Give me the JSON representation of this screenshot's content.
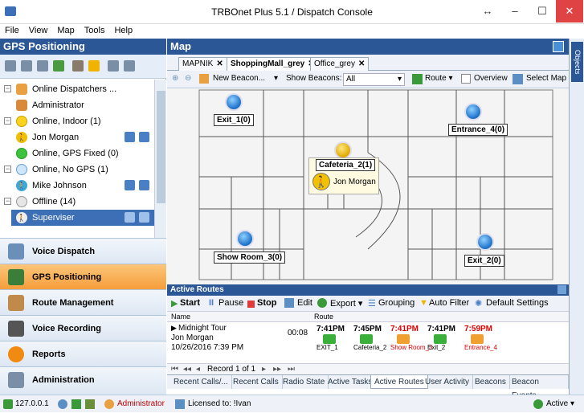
{
  "window": {
    "title": "TRBOnet Plus 5.1 / Dispatch Console",
    "restore_glyph": "↔",
    "min_glyph": "–",
    "max_glyph": "☐",
    "close_glyph": "✕"
  },
  "menu": [
    "File",
    "View",
    "Map",
    "Tools",
    "Help"
  ],
  "left_panel": {
    "title": "GPS Positioning",
    "tree": [
      {
        "label": "Online Dispatchers ...",
        "icon": "dispatcher-group-icon"
      },
      {
        "label": "Administrator",
        "icon": "dispatcher-user-icon"
      },
      {
        "label": "Online, Indoor (1)",
        "icon": "yellow-circle-icon"
      },
      {
        "label": "Jon Morgan",
        "icon": "radio-user-icon"
      },
      {
        "label": "Online, GPS Fixed (0)",
        "icon": "green-circle-icon"
      },
      {
        "label": "Online, No GPS (1)",
        "icon": "blue-circle-icon"
      },
      {
        "label": "Mike Johnson",
        "icon": "radio-user-icon"
      },
      {
        "label": "Offline (14)",
        "icon": "gray-circle-icon"
      },
      {
        "label": "Superviser",
        "icon": "radio-user-icon"
      }
    ],
    "nav": [
      {
        "label": "Voice Dispatch",
        "icon": "voice-dispatch-icon"
      },
      {
        "label": "GPS Positioning",
        "icon": "gps-positioning-icon"
      },
      {
        "label": "Route Management",
        "icon": "route-management-icon"
      },
      {
        "label": "Voice Recording",
        "icon": "voice-recording-icon"
      },
      {
        "label": "Reports",
        "icon": "reports-icon"
      },
      {
        "label": "Administration",
        "icon": "administration-icon"
      }
    ]
  },
  "map": {
    "title": "Map",
    "tabs": [
      {
        "label": "MAPNIK",
        "close": "✕"
      },
      {
        "label": "ShoppingMall_grey",
        "close": "✕"
      },
      {
        "label": "Office_grey",
        "close": "✕"
      }
    ],
    "toolbar": {
      "beacon_select": "New Beacon...",
      "show_beacons_label": "Show Beacons:",
      "show_beacons_value": "All",
      "route": "Route ▾",
      "overview": "Overview",
      "select_map": "Select Map"
    },
    "beacons": [
      {
        "label": "Exit_1(0)"
      },
      {
        "label": "Entrance_4(0)"
      },
      {
        "label": "Cafeteria_2(1)"
      },
      {
        "label": "Show Room_3(0)"
      },
      {
        "label": "Exit_2(0)"
      }
    ],
    "cafeteria_person": "Jon Morgan"
  },
  "active_routes": {
    "title": "Active Routes",
    "toolbar": {
      "start": "Start",
      "pause": "Pause",
      "stop": "Stop",
      "edit": "Edit",
      "export": "Export ▾",
      "grouping": "Grouping",
      "auto_filter": "Auto Filter",
      "default_settings": "Default Settings"
    },
    "columns": [
      "Name",
      "Route"
    ],
    "row": {
      "name": "Midnight Tour",
      "person": "Jon Morgan",
      "date": "10/26/2016 7:39 PM",
      "duration": "00:08",
      "stops": [
        {
          "time": "7:41PM",
          "name": "EXIT_1",
          "color": "#000000"
        },
        {
          "time": "7:45PM",
          "name": "Cafeteria_2",
          "color": "#000000"
        },
        {
          "time": "7:41PM",
          "name": "Show Room_3",
          "color": "#e00000"
        },
        {
          "time": "7:41PM",
          "name": "Exit_2",
          "color": "#000000"
        },
        {
          "time": "7:59PM",
          "name": "Entrance_4",
          "color": "#e00000"
        }
      ]
    },
    "pager": "Record 1 of 1",
    "tabs": [
      "Recent Calls/...",
      "Recent Calls",
      "Radio State",
      "Active Tasks",
      "Active Routes",
      "User Activity",
      "Beacons",
      "Beacon Events"
    ]
  },
  "objects_label": "Objects",
  "status": {
    "ip": "127.0.0.1",
    "user": "Administrator",
    "license": "Licensed to: !Ivan",
    "state": "Active ▾"
  }
}
